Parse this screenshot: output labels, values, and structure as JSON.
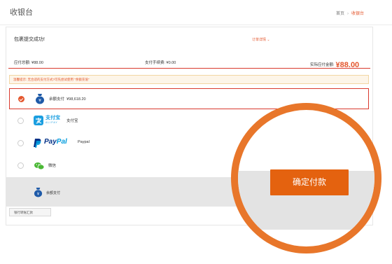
{
  "header": {
    "title": "收银台",
    "breadcrumb": [
      "首页",
      "收银台"
    ]
  },
  "order": {
    "success_text": "包裹提交成功!",
    "details_link": "订单详情 ⌄",
    "total_label": "应付总额: ¥88.00",
    "fee_label": "支付手续费: ¥0.00",
    "actual_label": "实际应付金额:",
    "actual_amount": "¥88.00"
  },
  "notice": "温馨提示: 无合适的支付方式?可先尝试使用 \"余额充值\"",
  "payment_methods": [
    {
      "name": "余额支付",
      "extra": "¥98,618.20",
      "icon": "wallet-icon",
      "selected": true
    },
    {
      "name": "支付宝",
      "icon": "alipay-icon",
      "logo_main": "支付宝",
      "logo_sub": "ALIPAY",
      "selected": false
    },
    {
      "name": "Paypal",
      "icon": "paypal-icon",
      "logo_a": "Pay",
      "logo_b": "Pal",
      "selected": false
    },
    {
      "name": "微信",
      "icon": "wechat-icon",
      "selected": false
    }
  ],
  "footer": {
    "selected_method": "余额支付",
    "bank_transfer_tab": "银行转账汇款",
    "confirm_button": "确定付款"
  },
  "colors": {
    "accent": "#e4572e",
    "button": "#e4620f",
    "highlight_ring": "#e8762a",
    "wallet": "#1e5aa8",
    "alipay": "#1a9ee0",
    "paypal_dark": "#003087",
    "paypal_light": "#009cde",
    "wechat": "#4ab835"
  }
}
